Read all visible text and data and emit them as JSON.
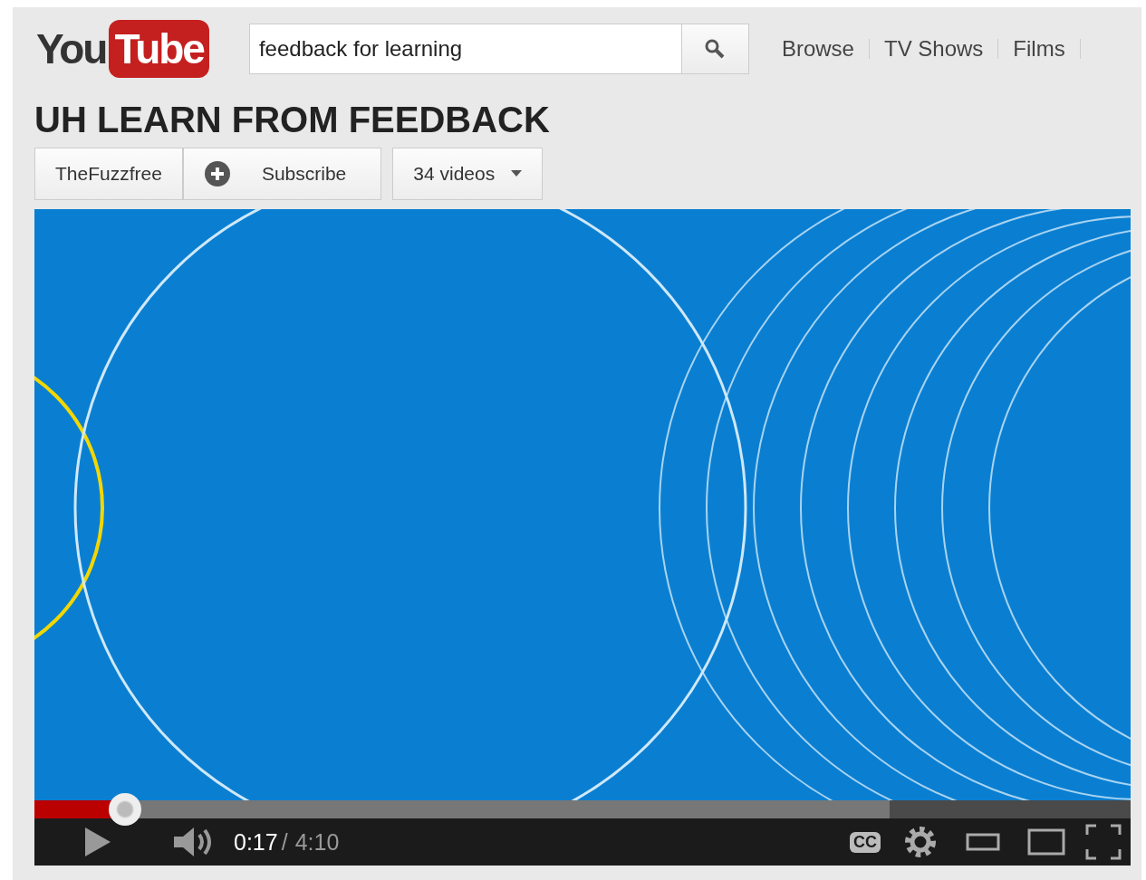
{
  "logo": {
    "part_1": "You",
    "part_2": "Tube"
  },
  "search": {
    "value": "feedback for learning"
  },
  "nav": [
    {
      "label": "Browse"
    },
    {
      "label": "TV Shows"
    },
    {
      "label": "Films"
    }
  ],
  "title": "UH LEARN FROM FEEDBACK",
  "channel": {
    "name": "TheFuzzfree",
    "subscribe": "Subscribe",
    "videos": "34 videos"
  },
  "player": {
    "progress": {
      "level": 0.083
    },
    "buffer": {
      "level": 0.78
    },
    "current_time": "0:17",
    "separator": "/",
    "duration": "4:10",
    "cc": "CC"
  }
}
